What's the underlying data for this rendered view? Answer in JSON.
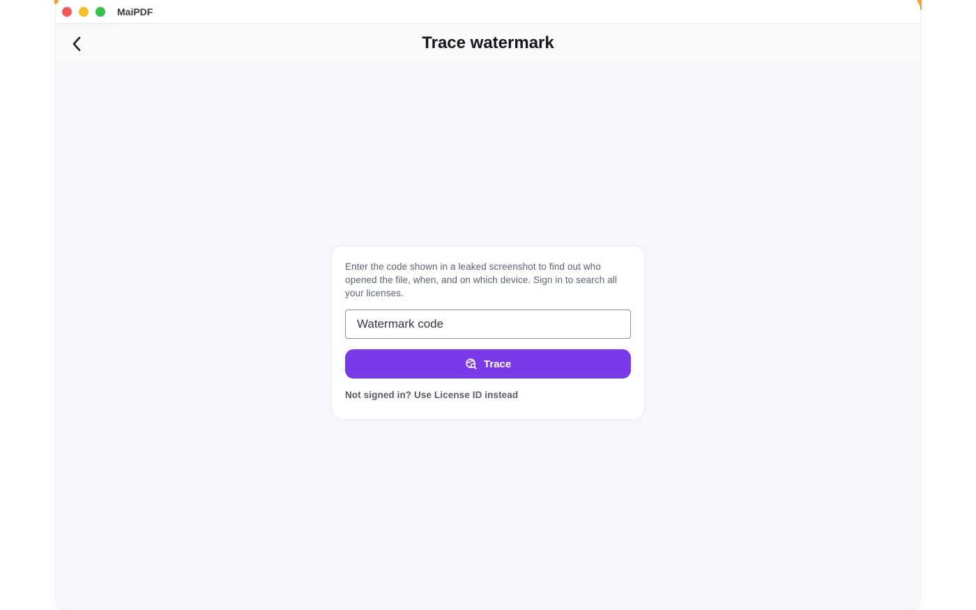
{
  "window": {
    "app_title": "MaiPDF"
  },
  "header": {
    "title": "Trace watermark"
  },
  "card": {
    "description": "Enter the code shown in a leaked screenshot to find out who opened the file, when, and on which device. Sign in to search all your licenses.",
    "input_placeholder": "Watermark code",
    "input_value": "",
    "trace_label": "Trace",
    "alt_link": "Not signed in? Use License ID instead"
  },
  "colors": {
    "accent": "#7b3aea",
    "background": "#f6f7fa"
  },
  "icons": {
    "back": "chevron-left-icon",
    "trace": "search-globe-icon"
  }
}
